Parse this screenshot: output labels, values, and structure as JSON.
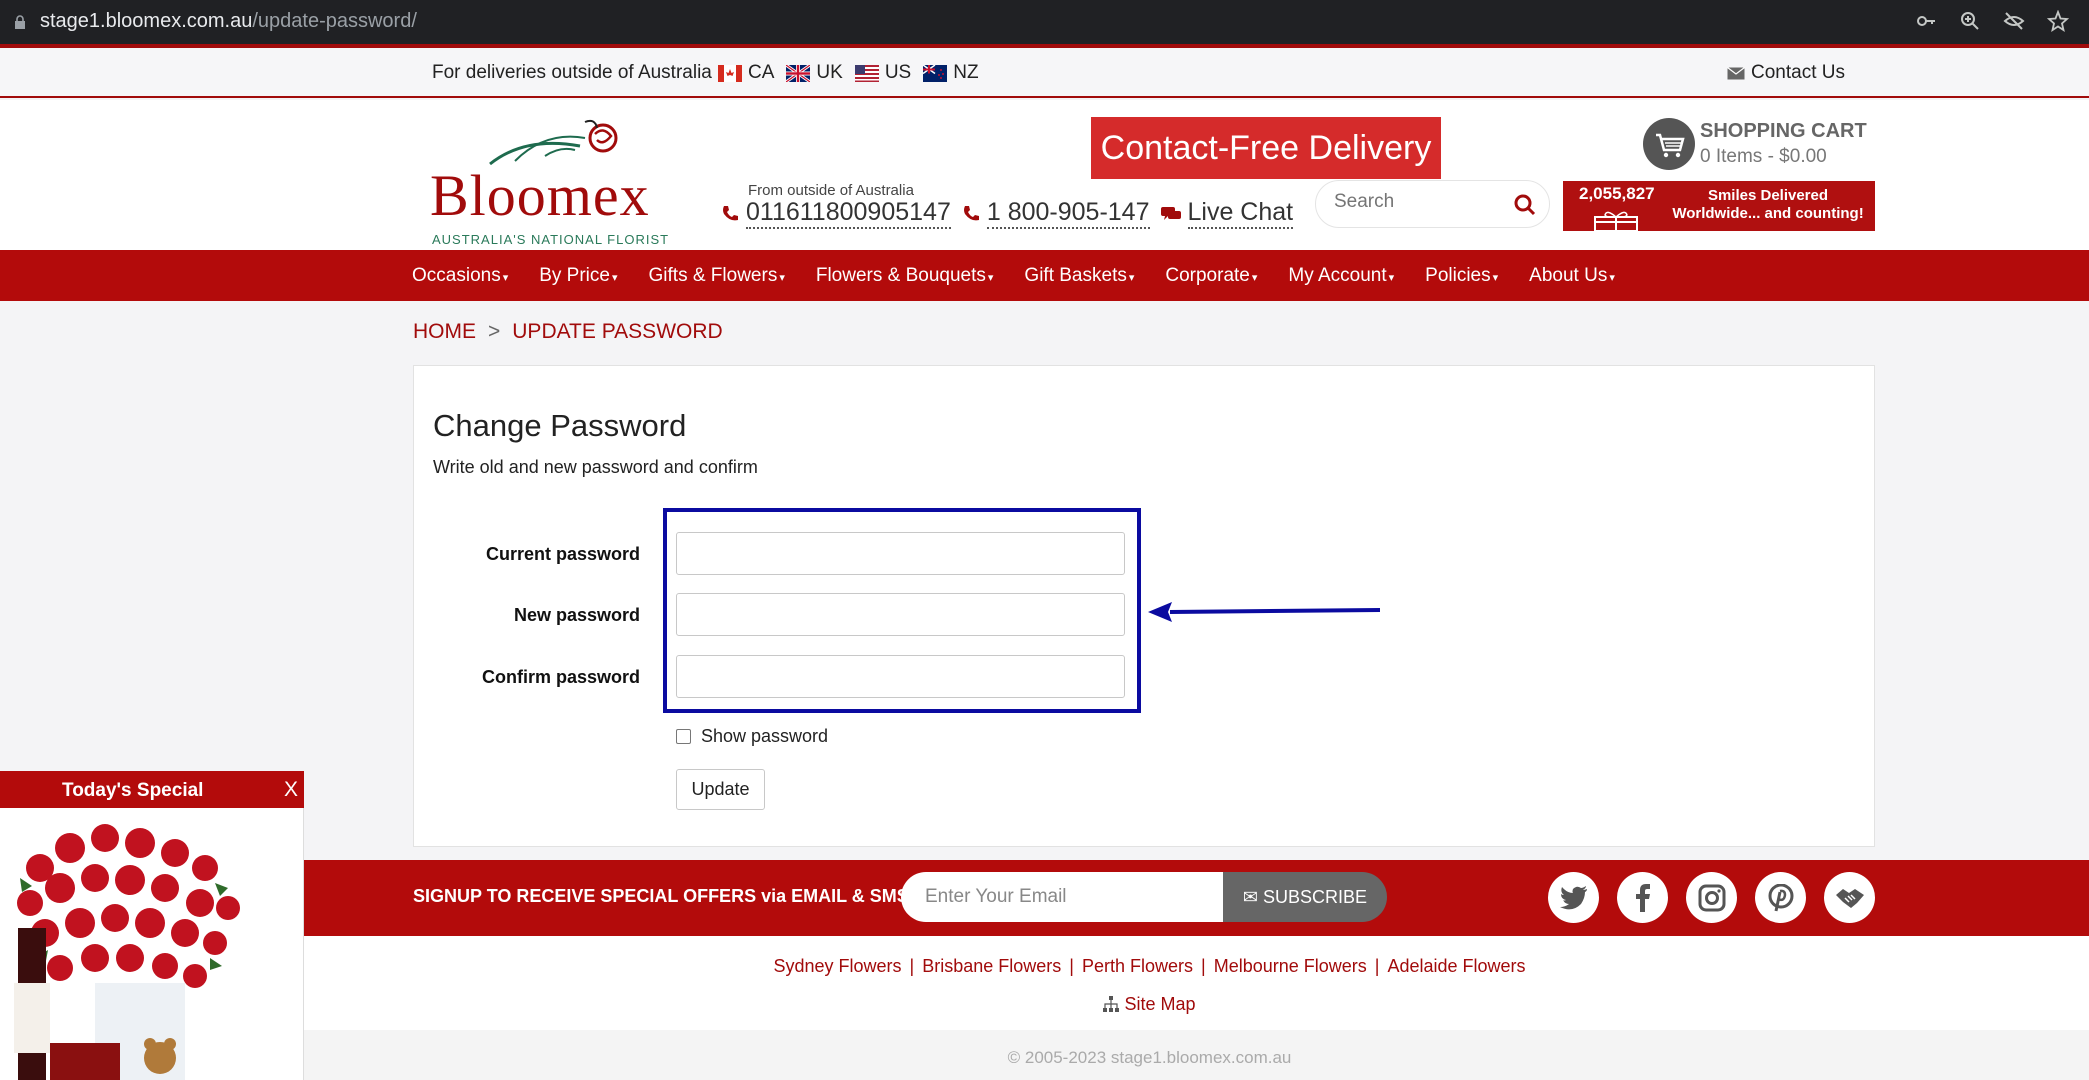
{
  "browser": {
    "url_host": "stage1.bloomex.com.au",
    "url_path": "/update-password/"
  },
  "topbar": {
    "delivery_text": "For deliveries outside of Australia",
    "flags": [
      {
        "code": "CA"
      },
      {
        "code": "UK"
      },
      {
        "code": "US"
      },
      {
        "code": "NZ"
      }
    ],
    "contact_label": "Contact Us"
  },
  "header": {
    "logo_word": "Bloomex",
    "logo_tagline": "AUSTRALIA'S NATIONAL FLORIST",
    "phone_from_label": "From outside of Australia",
    "intl_phone": "011611800905147",
    "local_phone": "1 800-905-147",
    "live_chat": "Live Chat",
    "banner_text": "Contact-Free Delivery",
    "search_placeholder": "Search",
    "cart_title": "SHOPPING CART",
    "cart_summary": "0 Items - $0.00",
    "smiles_count": "2,055,827",
    "smiles_text": "Smiles Delivered Worldwide... and counting!"
  },
  "nav": {
    "items": [
      "Occasions",
      "By Price",
      "Gifts & Flowers",
      "Flowers & Bouquets",
      "Gift Baskets",
      "Corporate",
      "My Account",
      "Policies",
      "About Us"
    ]
  },
  "breadcrumb": {
    "home": "HOME",
    "separator": ">",
    "current": "UPDATE PASSWORD"
  },
  "form": {
    "title": "Change Password",
    "description": "Write old and new password and confirm",
    "current_label": "Current password",
    "new_label": "New password",
    "confirm_label": "Confirm password",
    "show_password_label": "Show password",
    "update_label": "Update"
  },
  "signup": {
    "text": "SIGNUP TO RECEIVE SPECIAL OFFERS via EMAIL & SMS",
    "email_placeholder": "Enter Your Email",
    "subscribe_label": "SUBSCRIBE"
  },
  "footer": {
    "cities": [
      "Sydney Flowers",
      "Brisbane Flowers",
      "Perth Flowers",
      "Melbourne Flowers",
      "Adelaide Flowers"
    ],
    "sitemap": "Site Map",
    "copyright": "© 2005-2023 stage1.bloomex.com.au"
  },
  "special": {
    "title": "Today's Special",
    "close": "X"
  },
  "colors": {
    "brand_red": "#b30b0b",
    "highlight_blue": "#0b0ba0"
  }
}
